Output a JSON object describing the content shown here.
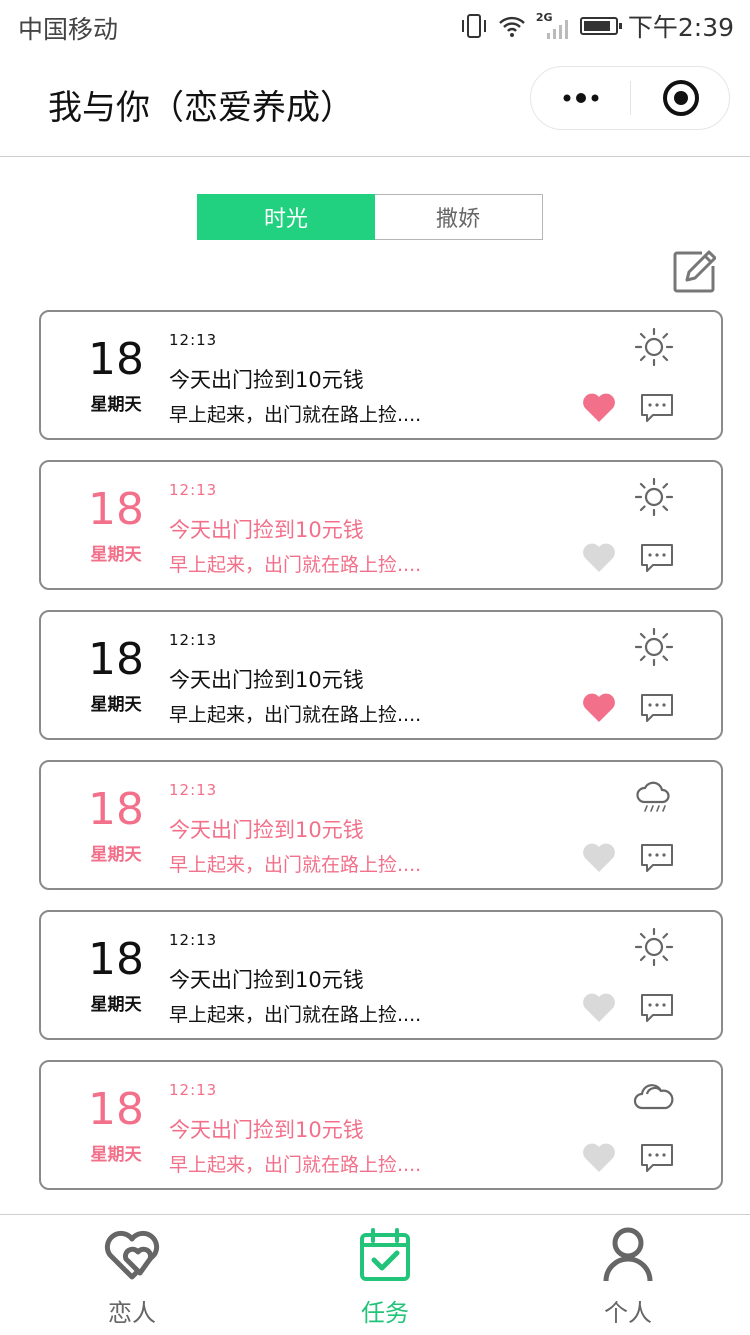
{
  "status_bar": {
    "carrier": "中国移动",
    "network": "2G",
    "time": "下午2:39"
  },
  "nav": {
    "title": "我与你（恋爱养成）"
  },
  "segment": {
    "tabs": [
      "时光",
      "撒娇"
    ],
    "active_index": 0
  },
  "cards": [
    {
      "day": "18",
      "weekday": "星期天",
      "time": "12:13",
      "title": "今天出门捡到10元钱",
      "desc": "早上起来，出门就在路上捡....",
      "weather": "sun-icon",
      "liked": true,
      "style": "dark"
    },
    {
      "day": "18",
      "weekday": "星期天",
      "time": "12:13",
      "title": "今天出门捡到10元钱",
      "desc": "早上起来，出门就在路上捡....",
      "weather": "sun-icon",
      "liked": false,
      "style": "pink"
    },
    {
      "day": "18",
      "weekday": "星期天",
      "time": "12:13",
      "title": "今天出门捡到10元钱",
      "desc": "早上起来，出门就在路上捡....",
      "weather": "sun-icon",
      "liked": true,
      "style": "dark"
    },
    {
      "day": "18",
      "weekday": "星期天",
      "time": "12:13",
      "title": "今天出门捡到10元钱",
      "desc": "早上起来，出门就在路上捡....",
      "weather": "rain-cloud-icon",
      "liked": false,
      "style": "pink"
    },
    {
      "day": "18",
      "weekday": "星期天",
      "time": "12:13",
      "title": "今天出门捡到10元钱",
      "desc": "早上起来，出门就在路上捡....",
      "weather": "sun-icon",
      "liked": false,
      "style": "dark"
    },
    {
      "day": "18",
      "weekday": "星期天",
      "time": "12:13",
      "title": "今天出门捡到10元钱",
      "desc": "早上起来，出门就在路上捡....",
      "weather": "cloud-icon",
      "liked": false,
      "style": "pink"
    }
  ],
  "tab_bar": {
    "items": [
      {
        "label": "恋人",
        "icon": "hearts-icon"
      },
      {
        "label": "任务",
        "icon": "calendar-check-icon"
      },
      {
        "label": "个人",
        "icon": "person-icon"
      }
    ],
    "active_index": 1
  },
  "colors": {
    "accent_green": "#22d17f",
    "pink": "#f2708a",
    "heart_liked": "#f2708a",
    "heart_unliked": "#d9d9d9"
  }
}
